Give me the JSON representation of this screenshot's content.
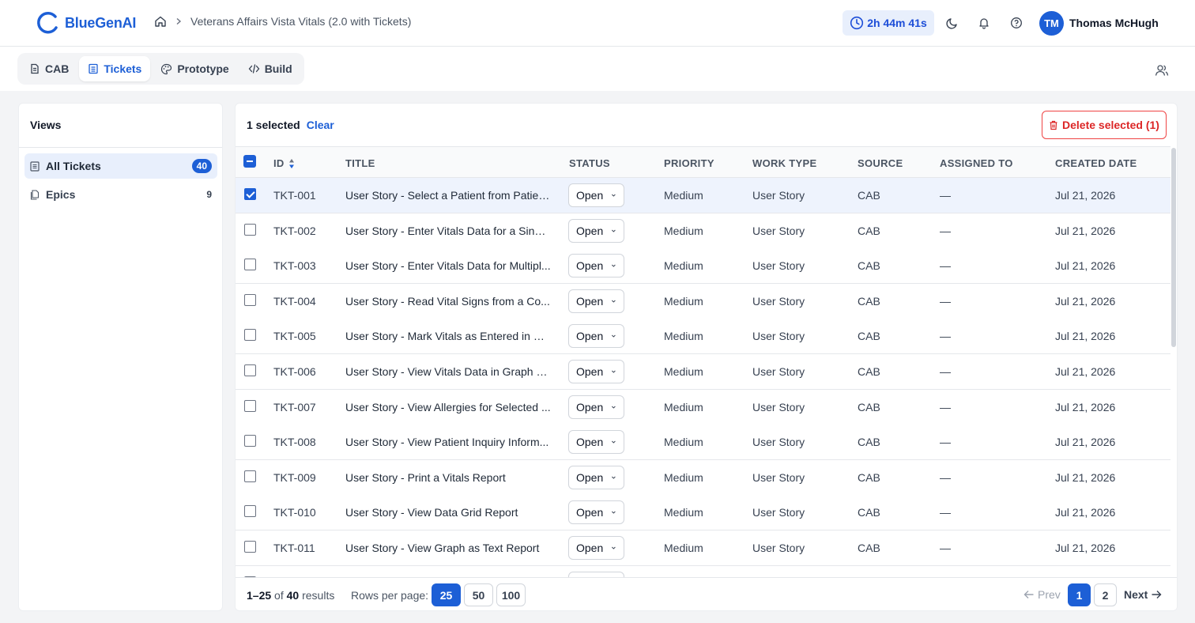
{
  "app": {
    "brand": "BlueGenAI"
  },
  "breadcrumb": {
    "project": "Veterans Affairs Vista Vitals (2.0 with Tickets)"
  },
  "timer": {
    "value": "2h 44m 41s"
  },
  "user": {
    "initials": "TM",
    "name": "Thomas McHugh"
  },
  "tabs": [
    {
      "label": "CAB",
      "icon": "document-icon",
      "active": false
    },
    {
      "label": "Tickets",
      "icon": "list-icon",
      "active": true
    },
    {
      "label": "Prototype",
      "icon": "palette-icon",
      "active": false
    },
    {
      "label": "Build",
      "icon": "code-icon",
      "active": false
    }
  ],
  "views": {
    "title": "Views",
    "items": [
      {
        "label": "All Tickets",
        "count": "40",
        "active": true
      },
      {
        "label": "Epics",
        "count": "9",
        "active": false
      }
    ]
  },
  "selection": {
    "count_text": "1 selected",
    "clear_label": "Clear",
    "delete_label": "Delete selected (1)"
  },
  "table": {
    "columns": [
      "ID",
      "TITLE",
      "STATUS",
      "PRIORITY",
      "WORK TYPE",
      "SOURCE",
      "ASSIGNED TO",
      "CREATED DATE"
    ],
    "rows": [
      {
        "id": "TKT-001",
        "title": "User Story - Select a Patient from Patien...",
        "status": "Open",
        "priority": "Medium",
        "work_type": "User Story",
        "source": "CAB",
        "assigned": "—",
        "created": "Jul 21, 2026",
        "selected": true
      },
      {
        "id": "TKT-002",
        "title": "User Story - Enter Vitals Data for a Singl...",
        "status": "Open",
        "priority": "Medium",
        "work_type": "User Story",
        "source": "CAB",
        "assigned": "—",
        "created": "Jul 21, 2026",
        "selected": false
      },
      {
        "id": "TKT-003",
        "title": "User Story - Enter Vitals Data for Multipl...",
        "status": "Open",
        "priority": "Medium",
        "work_type": "User Story",
        "source": "CAB",
        "assigned": "—",
        "created": "Jul 21, 2026",
        "selected": false
      },
      {
        "id": "TKT-004",
        "title": "User Story - Read Vital Signs from a Co...",
        "status": "Open",
        "priority": "Medium",
        "work_type": "User Story",
        "source": "CAB",
        "assigned": "—",
        "created": "Jul 21, 2026",
        "selected": false
      },
      {
        "id": "TKT-005",
        "title": "User Story - Mark Vitals as Entered in Er...",
        "status": "Open",
        "priority": "Medium",
        "work_type": "User Story",
        "source": "CAB",
        "assigned": "—",
        "created": "Jul 21, 2026",
        "selected": false
      },
      {
        "id": "TKT-006",
        "title": "User Story - View Vitals Data in Graph a...",
        "status": "Open",
        "priority": "Medium",
        "work_type": "User Story",
        "source": "CAB",
        "assigned": "—",
        "created": "Jul 21, 2026",
        "selected": false
      },
      {
        "id": "TKT-007",
        "title": "User Story - View Allergies for Selected ...",
        "status": "Open",
        "priority": "Medium",
        "work_type": "User Story",
        "source": "CAB",
        "assigned": "—",
        "created": "Jul 21, 2026",
        "selected": false
      },
      {
        "id": "TKT-008",
        "title": "User Story - View Patient Inquiry Inform...",
        "status": "Open",
        "priority": "Medium",
        "work_type": "User Story",
        "source": "CAB",
        "assigned": "—",
        "created": "Jul 21, 2026",
        "selected": false
      },
      {
        "id": "TKT-009",
        "title": "User Story - Print a Vitals Report",
        "status": "Open",
        "priority": "Medium",
        "work_type": "User Story",
        "source": "CAB",
        "assigned": "—",
        "created": "Jul 21, 2026",
        "selected": false
      },
      {
        "id": "TKT-010",
        "title": "User Story - View Data Grid Report",
        "status": "Open",
        "priority": "Medium",
        "work_type": "User Story",
        "source": "CAB",
        "assigned": "—",
        "created": "Jul 21, 2026",
        "selected": false
      },
      {
        "id": "TKT-011",
        "title": "User Story - View Graph as Text Report",
        "status": "Open",
        "priority": "Medium",
        "work_type": "User Story",
        "source": "CAB",
        "assigned": "—",
        "created": "Jul 21, 2026",
        "selected": false
      },
      {
        "id": "",
        "title": "",
        "status": "",
        "priority": "",
        "work_type": "",
        "source": "",
        "assigned": "",
        "created": "",
        "selected": false
      }
    ]
  },
  "footer": {
    "range": "1–25",
    "of": "of",
    "total": "40",
    "results_word": "results",
    "rows_per_page_label": "Rows per page:",
    "rows_per_page_options": [
      "25",
      "50",
      "100"
    ],
    "prev_label": "Prev",
    "next_label": "Next",
    "pages": [
      "1",
      "2"
    ]
  },
  "colors": {
    "accent": "#1d5fd6",
    "danger": "#dc2626",
    "background": "#f3f4f6"
  }
}
